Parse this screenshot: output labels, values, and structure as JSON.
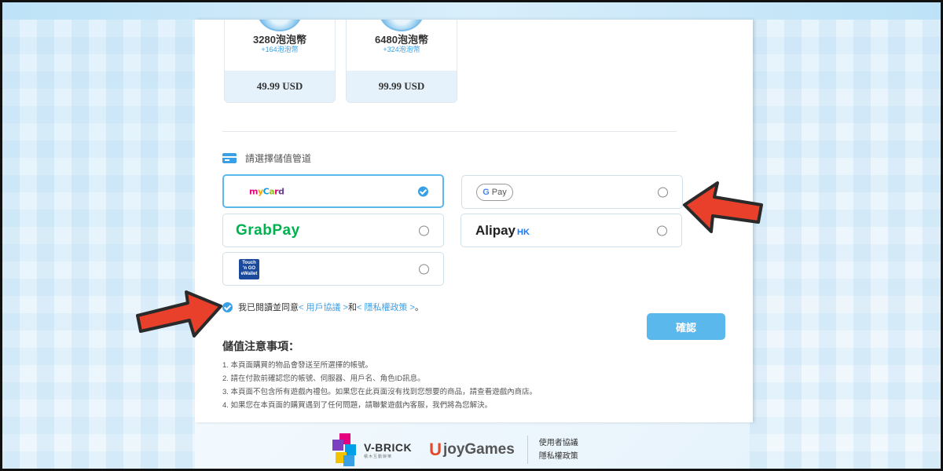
{
  "packages": [
    {
      "name": "3280泡泡幣",
      "bonus": "+164泡泡幣",
      "price": "49.99 USD"
    },
    {
      "name": "6480泡泡幣",
      "bonus": "+324泡泡幣",
      "price": "99.99 USD"
    }
  ],
  "payment": {
    "title": "請選擇儲值管道",
    "methods": [
      {
        "id": "mycard",
        "label": "MyCard",
        "selected": true
      },
      {
        "id": "gpay",
        "label": "G Pay",
        "selected": false
      },
      {
        "id": "grabpay",
        "label": "GrabPay",
        "selected": false
      },
      {
        "id": "alipayhk",
        "label": "Alipay",
        "label_suffix": "HK",
        "selected": false
      },
      {
        "id": "touchngo",
        "label": "Touch 'n Go eWallet",
        "selected": false
      }
    ]
  },
  "agreement": {
    "prefix": "我已閱讀並同意",
    "terms_link": "< 用戶協議 >",
    "conjunction": "和",
    "privacy_link": "< 隱私權政策 >",
    "suffix": "。"
  },
  "confirm_label": "確認",
  "notes": {
    "title": "儲值注意事項：",
    "items": [
      "1. 本頁面購買的物品會發送至所選擇的帳號。",
      "2. 請在付款前確認您的帳號、伺服器、用戶名、角色ID訊息。",
      "3. 本頁面不包含所有遊戲內禮包。如果您在此頁面沒有找到您想要的商品，請查看遊戲內商店。",
      "4. 如果您在本頁面的購買遇到了任何問題，請聯繫遊戲內客服，我們將為您解決。"
    ]
  },
  "footer": {
    "vbrick": "V-BRICK",
    "vbrick_sub": "積木互動娛樂",
    "ujoy_u": "U",
    "ujoy": "joyGames",
    "links": [
      "使用者協議",
      "隱私權政策"
    ]
  },
  "colors": {
    "accent": "#3aa0e6",
    "arrow": "#e8402a",
    "confirm": "#5bb8ec"
  }
}
